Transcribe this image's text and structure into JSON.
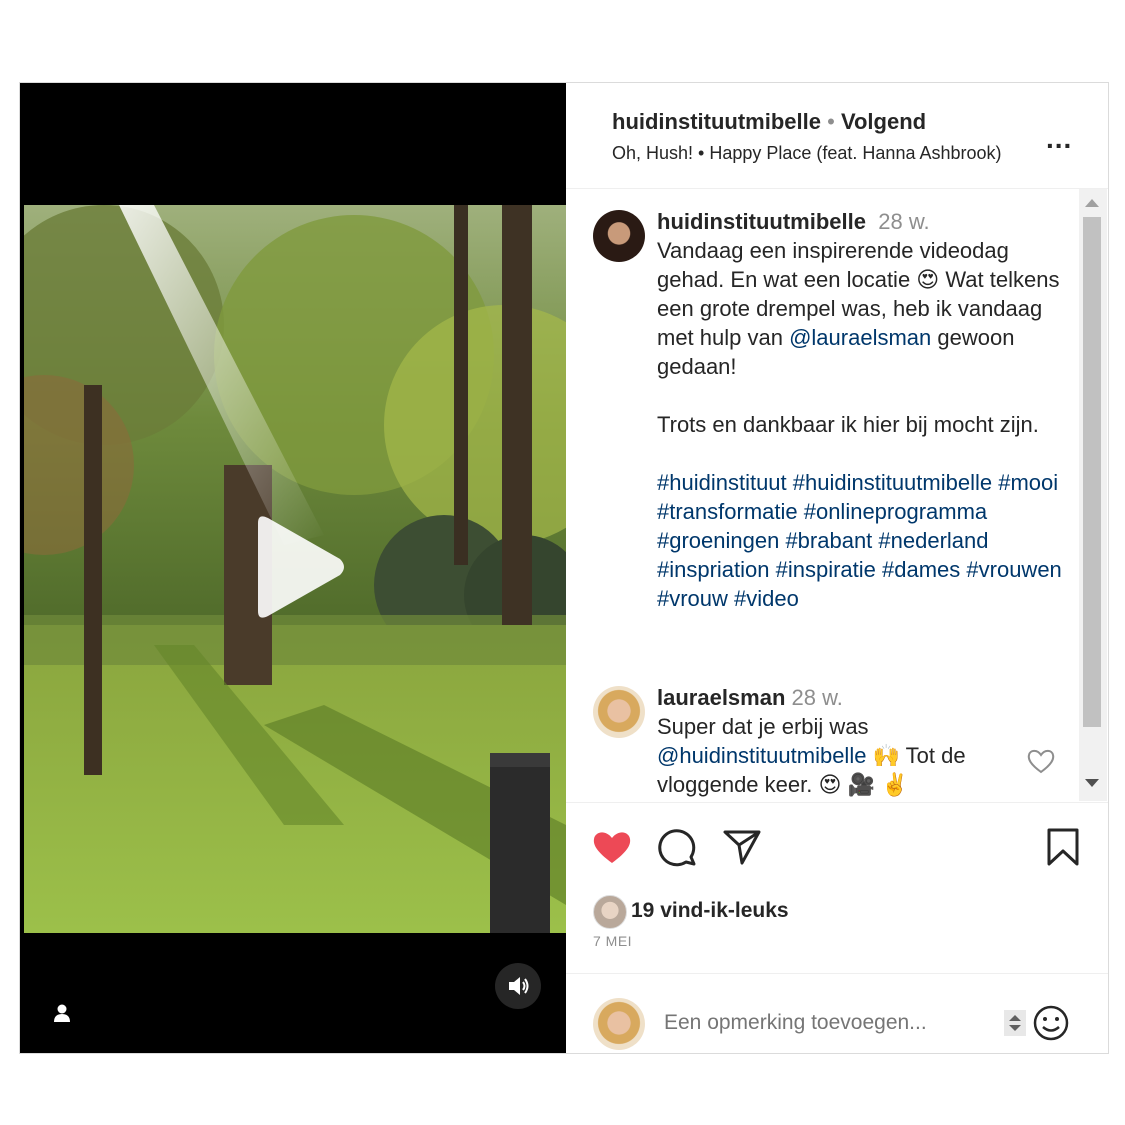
{
  "header": {
    "username": "huidinstituutmibelle",
    "separator": "•",
    "follow_status": "Volgend",
    "music": "Oh, Hush! • Happy Place (feat. Hanna Ashbrook)",
    "more_label": "..."
  },
  "comments": [
    {
      "username": "huidinstituutmibelle",
      "time": "28 w.",
      "text_before": "Vandaag een inspirerende videodag gehad. En wat een locatie 😍 Wat telkens een grote drempel was, heb ik vandaag met hulp van ",
      "mention": "@lauraelsman",
      "text_after": " gewoon gedaan!\n\nTrots en dankbaar ik hier bij mocht zijn.\n\n",
      "hashtags": "#huidinstituut #huidinstituutmibelle #mooi #transformatie #onlineprogramma #groeningen #brabant #nederland #inspriation #inspiratie #dames #vrouwen #vrouw #video"
    },
    {
      "username": "lauraelsman",
      "time": "28 w.",
      "text_before": "Super dat je erbij was ",
      "mention": "@huidinstituutmibelle",
      "text_after": " 🙌 Tot de vloggende keer. 😍 🎥 ✌️"
    }
  ],
  "likes": "19 vind-ik-leuks",
  "date": "7 MEI",
  "add_comment_placeholder": "Een opmerking toevoegen...",
  "colors": {
    "like_red": "#ed4956",
    "link_blue": "#00376b",
    "muted": "#8e8e8e"
  },
  "icons": [
    "play-icon",
    "volume-icon",
    "person-icon",
    "heart-icon",
    "comment-icon",
    "share-icon",
    "bookmark-icon",
    "emoji-icon",
    "more-icon"
  ]
}
